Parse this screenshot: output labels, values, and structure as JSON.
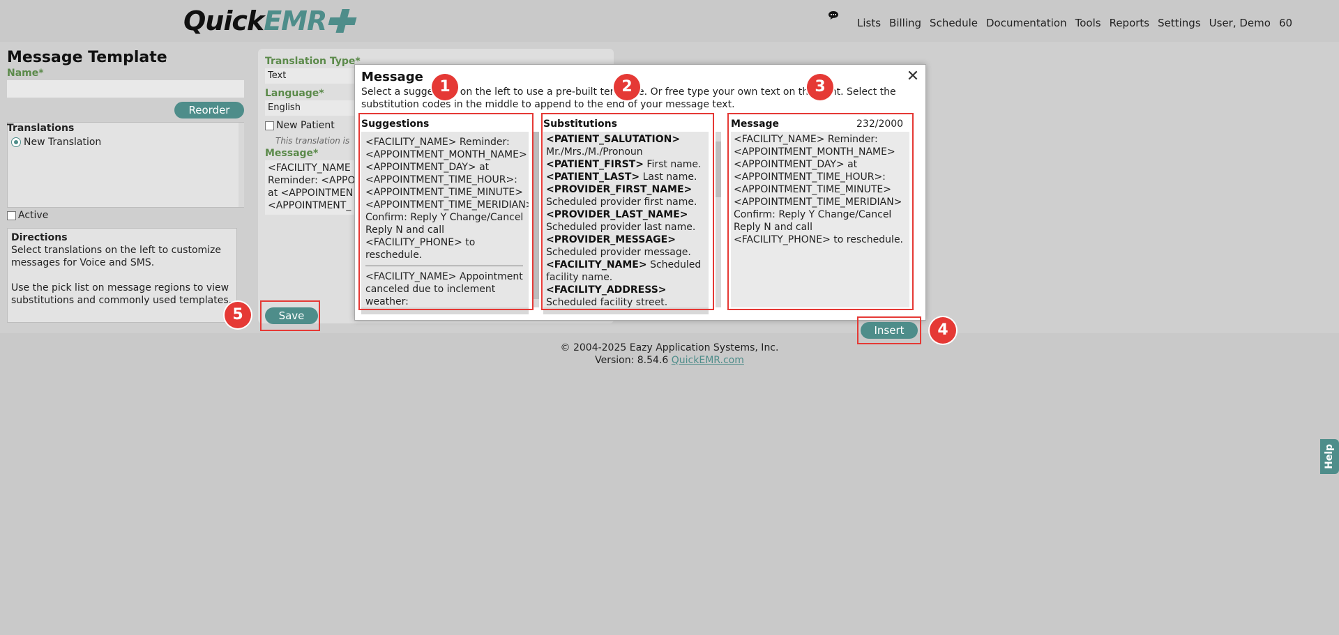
{
  "header": {
    "logo_quick": "Quick",
    "logo_emr": "EMR",
    "nav": [
      "Lists",
      "Billing",
      "Schedule",
      "Documentation",
      "Tools",
      "Reports",
      "Settings",
      "User, Demo",
      "60"
    ]
  },
  "page": {
    "title": "Message Template",
    "name_label": "Name*",
    "reorder_label": "Reorder",
    "translations_title": "Translations",
    "translation_item": "New Translation",
    "active_label": "Active",
    "directions_title": "Directions",
    "directions_p1": "Select translations on the left to customize messages for Voice and SMS.",
    "directions_p2": "Use the pick list on message regions to view substitutions and commonly used templates.",
    "translation_type_label": "Translation Type*",
    "translation_type_value": "Text",
    "language_label": "Language*",
    "language_value": "English",
    "new_patient_label": "New Patient",
    "translation_note": "This translation is",
    "message_label": "Message*",
    "message_preview": [
      "<FACILITY_NAME",
      "Reminder: <APPO",
      "at <APPOINTMEN",
      "<APPOINTMENT_"
    ],
    "save_label": "Save"
  },
  "footer": {
    "copyright": "© 2004-2025 Eazy Application Systems, Inc.",
    "version_prefix": "Version: 8.54.6 ",
    "link": "QuickEMR.com"
  },
  "modal": {
    "title": "Message",
    "close_glyph": "✕",
    "instructions": "Select a suggestion on the left to use a pre-built template. Or free type your own text on the right. Select the substitution codes in the middle to append to the end of your message text.",
    "suggestions_title": "Suggestions",
    "suggestions": [
      "<FACILITY_NAME> Reminder: <APPOINTMENT_MONTH_NAME> <APPOINTMENT_DAY> at <APPOINTMENT_TIME_HOUR>: <APPOINTMENT_TIME_MINUTE> <APPOINTMENT_TIME_MERIDIAN> Confirm: Reply Y Change/Cancel Reply N and call <FACILITY_PHONE> to reschedule.",
      "<FACILITY_NAME> Appointment canceled due to inclement weather:"
    ],
    "substitutions_title": "Substitutions",
    "substitutions": [
      {
        "code": "<PATIENT_SALUTATION>",
        "desc": "Mr./Mrs./M./Pronoun"
      },
      {
        "code": "<PATIENT_FIRST>",
        "desc": "First name."
      },
      {
        "code": "<PATIENT_LAST>",
        "desc": "Last name."
      },
      {
        "code": "<PROVIDER_FIRST_NAME>",
        "desc": "Scheduled provider first name."
      },
      {
        "code": "<PROVIDER_LAST_NAME>",
        "desc": "Scheduled provider last name."
      },
      {
        "code": "<PROVIDER_MESSAGE>",
        "desc": "Scheduled provider message."
      },
      {
        "code": "<FACILITY_NAME>",
        "desc": "Scheduled facility name."
      },
      {
        "code": "<FACILITY_ADDRESS>",
        "desc": "Scheduled facility street."
      }
    ],
    "message_title": "Message",
    "message_count": "232/2000",
    "message_text": "<FACILITY_NAME> Reminder: <APPOINTMENT_MONTH_NAME> <APPOINTMENT_DAY> at <APPOINTMENT_TIME_HOUR>: <APPOINTMENT_TIME_MINUTE> <APPOINTMENT_TIME_MERIDIAN> Confirm: Reply Y Change/Cancel Reply N and call <FACILITY_PHONE> to reschedule.",
    "insert_label": "Insert"
  },
  "badges": [
    "1",
    "2",
    "3",
    "4",
    "5"
  ],
  "help_label": "Help",
  "colors": {
    "accent": "#4e8d8a",
    "label_green": "#5b8a4a",
    "highlight_red": "#e53935"
  }
}
